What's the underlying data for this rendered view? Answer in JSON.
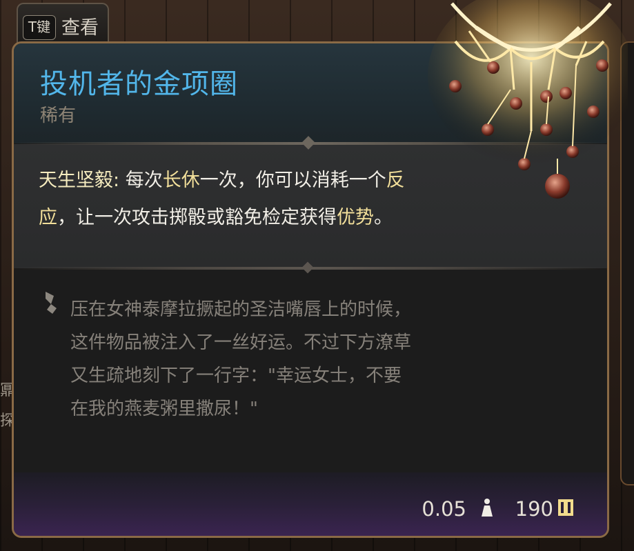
{
  "hotkey": {
    "key": "T键",
    "label": "查看"
  },
  "item": {
    "name": "投机者的金项圈",
    "rarity": "稀有",
    "effect_name": "天生坚毅:",
    "effect_seg1": " 每次",
    "effect_kw1": "长休",
    "effect_seg2": "一次，你可以消耗一个",
    "effect_kw2": "反应",
    "effect_seg3": "，让一次攻击掷骰或豁免检定获得",
    "effect_kw3": "优势",
    "effect_seg4": "。",
    "lore": "压在女神泰摩拉撅起的圣洁嘴唇上的时候，这件物品被注入了一丝好运。不过下方潦草又生疏地刻下了一行字：\"幸运女士，不要在我的燕麦粥里撒尿！\"",
    "weight": "0.05",
    "price": "190"
  },
  "background": {
    "left_glyphs": [
      "鼏",
      "探"
    ]
  },
  "colors": {
    "title": "#52b6ea",
    "rarity": "#8e8475",
    "effect_text": "#f1eee6",
    "keyword": "#f2df9a",
    "lore_text": "#86817a",
    "border": "#8a6a46"
  },
  "icons": {
    "weight": "weight-icon",
    "currency": "gold-coin-icon",
    "lore": "quill-icon"
  }
}
